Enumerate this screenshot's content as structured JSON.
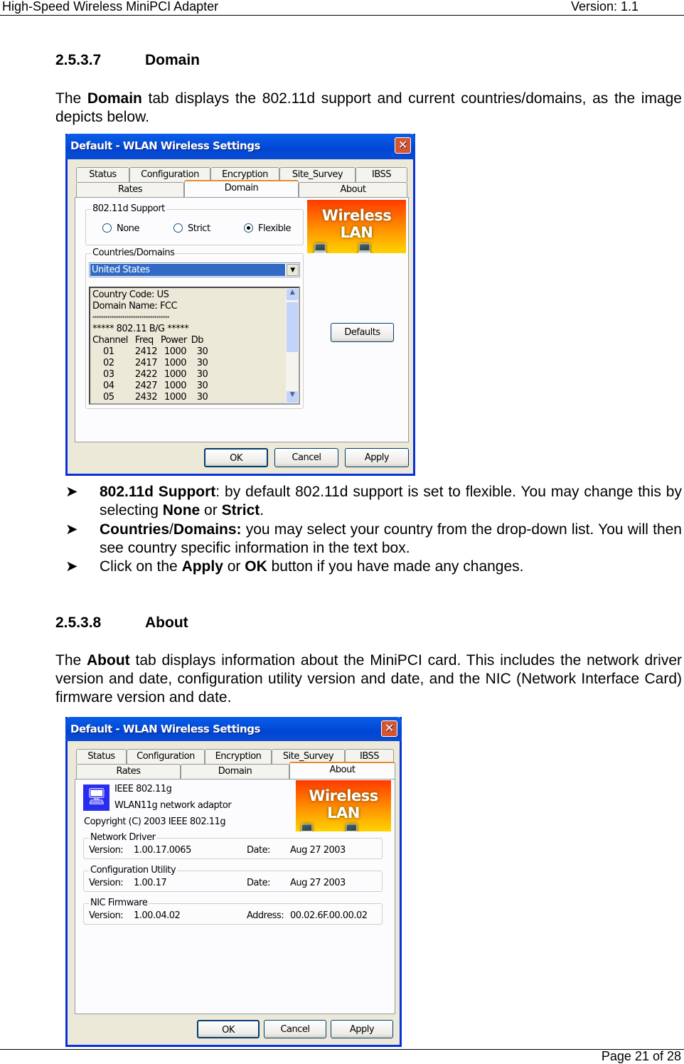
{
  "header": {
    "left": "High-Speed Wireless MiniPCI Adapter",
    "right": "Version: 1.1"
  },
  "footer": {
    "page": "Page 21 of 28"
  },
  "s1": {
    "num": "2.5.3.7",
    "title": "Domain",
    "p_pre": "The ",
    "p_bold": "Domain",
    "p_post": " tab displays the 802.11d support and current countries/domains, as the image depicts below."
  },
  "dialog_title": "Default - WLAN Wireless Settings",
  "tabs": {
    "status": "Status",
    "config": "Configuration",
    "enc": "Encryption",
    "site": "Site_Survey",
    "ibss": "IBSS",
    "rates": "Rates",
    "domain": "Domain",
    "about": "About"
  },
  "logo_text": "Wireless LAN",
  "buttons": {
    "ok": "OK",
    "cancel": "Cancel",
    "apply": "Apply",
    "defaults": "Defaults"
  },
  "domain": {
    "support_label": "802.11d Support",
    "none": "None",
    "strict": "Strict",
    "flexible": "Flexible",
    "selected": "Flexible",
    "countries_label": "Countries/Domains",
    "country": "United States",
    "info": [
      "Country Code: US",
      "Domain Name: FCC",
      "************************************",
      "***** 802.11 B/G *****"
    ],
    "table_head": [
      "Channel",
      "Freq",
      "Power",
      "Db"
    ],
    "rows": [
      [
        "01",
        "2412",
        "1000",
        "30"
      ],
      [
        "02",
        "2417",
        "1000",
        "30"
      ],
      [
        "03",
        "2422",
        "1000",
        "30"
      ],
      [
        "04",
        "2427",
        "1000",
        "30"
      ],
      [
        "05",
        "2432",
        "1000",
        "30"
      ]
    ]
  },
  "bullets": [
    {
      "b": "802.11d Support",
      "t1": ": by default 802.11d support is set to flexible.  You may change this by selecting ",
      "b2": "None",
      "t2": " or ",
      "b3": "Strict",
      "t3": "."
    },
    {
      "b": "Countries",
      "t1": "/",
      "b2": "Domains:",
      "t2": " you may select your country from the drop-down list. You will then see country specific information in the text box."
    },
    {
      "t0": "Click on the ",
      "b": "Apply",
      "t1": " or ",
      "b2": "OK",
      "t2": " button if you have made any changes."
    }
  ],
  "s2": {
    "num": "2.5.3.8",
    "title": "About",
    "p_pre": "The ",
    "p_bold": "About",
    "p_post": " tab displays information about the MiniPCI card. This includes the network driver version and date, configuration utility version and date, and the NIC (Network Interface Card) firmware version and date."
  },
  "about": {
    "line1": "IEEE 802.11g",
    "line2": "WLAN11g network adaptor",
    "copyright": "Copyright (C) 2003  IEEE 802.11g",
    "groups": [
      {
        "label": "Network Driver",
        "k1": "Version:",
        "v1": "1.00.17.0065",
        "k2": "Date:",
        "v2": "Aug 27 2003"
      },
      {
        "label": "Configuration Utility",
        "k1": "Version:",
        "v1": "1.00.17",
        "k2": "Date:",
        "v2": "Aug 27 2003"
      },
      {
        "label": "NIC Firmware",
        "k1": "Version:",
        "v1": "1.00.04.02",
        "k2": "Address:",
        "v2": "00.02.6F.00.00.02"
      }
    ]
  }
}
